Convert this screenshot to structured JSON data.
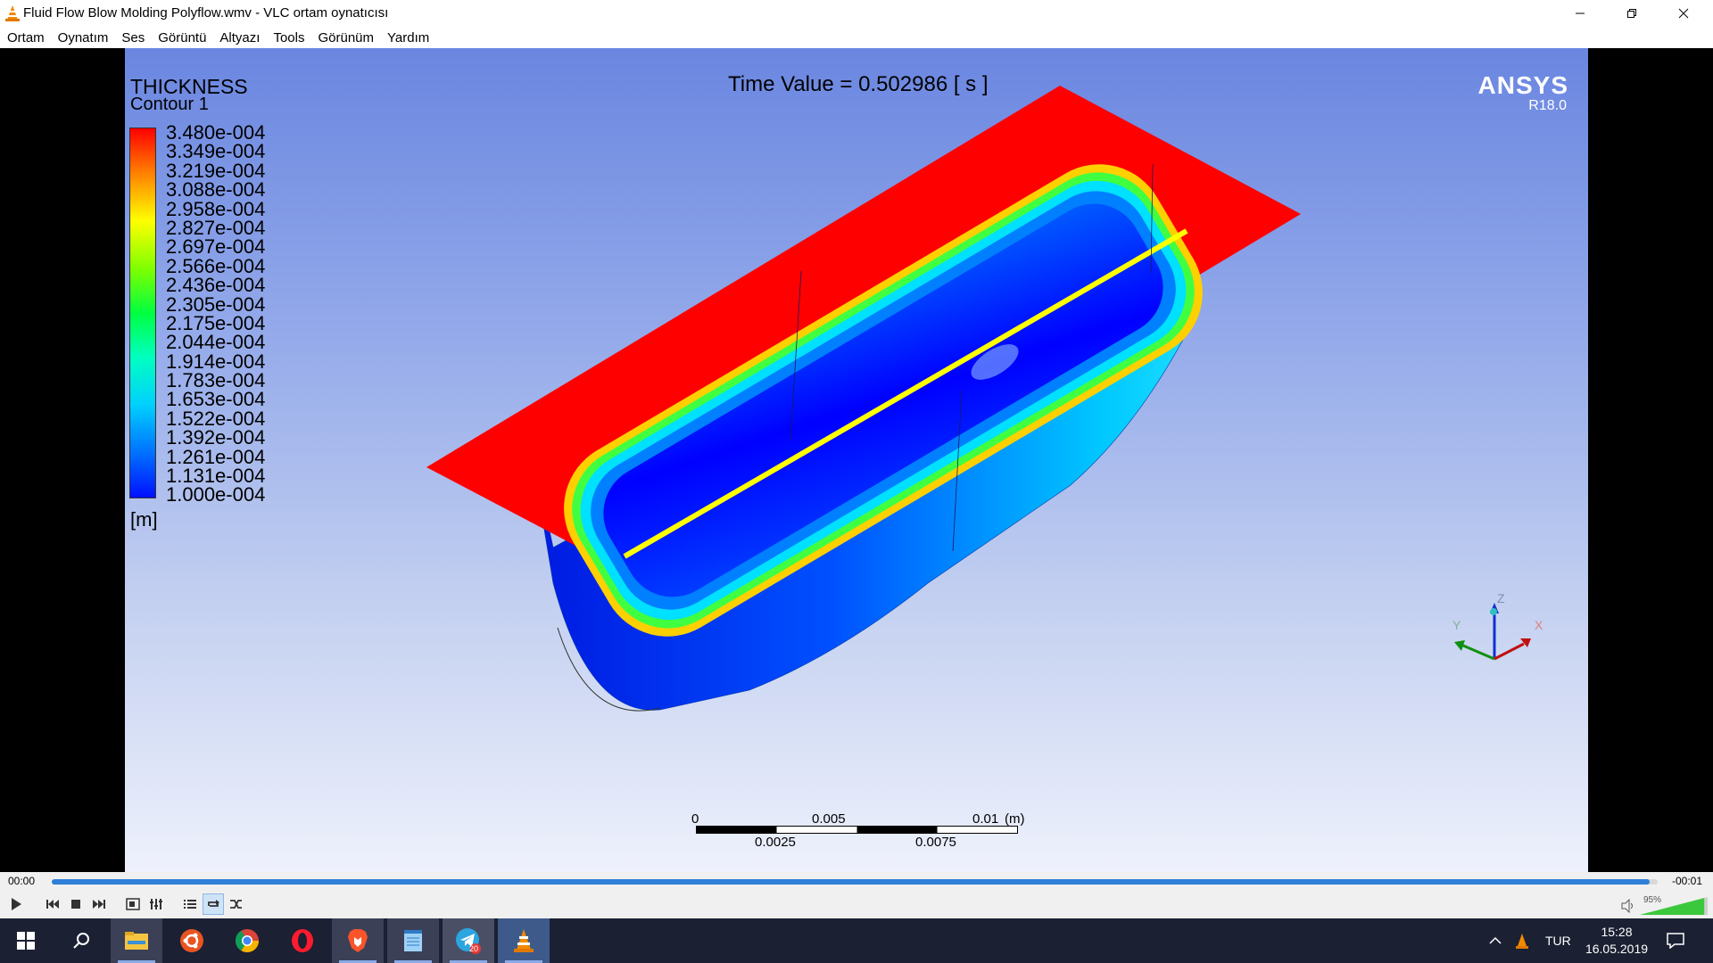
{
  "window": {
    "title": "Fluid Flow Blow Molding Polyflow.wmv - VLC ortam oynatıcısı",
    "icon": "vlc-cone-icon",
    "controls": [
      "minimize-icon",
      "restore-icon",
      "close-icon"
    ]
  },
  "menu": [
    "Ortam",
    "Oynatım",
    "Ses",
    "Görüntü",
    "Altyazı",
    "Tools",
    "Görünüm",
    "Yardım"
  ],
  "video": {
    "legend_title": "THICKNESS",
    "legend_subtitle": "Contour 1",
    "legend_values": [
      "3.480e-004",
      "3.349e-004",
      "3.219e-004",
      "3.088e-004",
      "2.958e-004",
      "2.827e-004",
      "2.697e-004",
      "2.566e-004",
      "2.436e-004",
      "2.305e-004",
      "2.175e-004",
      "2.044e-004",
      "1.914e-004",
      "1.783e-004",
      "1.653e-004",
      "1.522e-004",
      "1.392e-004",
      "1.261e-004",
      "1.131e-004",
      "1.000e-004"
    ],
    "legend_unit": "[m]",
    "time_value": "Time Value = 0.502986 [ s ]",
    "brand": "ANSYS",
    "brand_version": "R18.0",
    "axes": {
      "z": "Z",
      "y": "Y",
      "x": "X"
    },
    "scale_top": [
      "0",
      "0.005",
      "0.01",
      "(m)"
    ],
    "scale_bottom": [
      "0.0025",
      "0.0075"
    ]
  },
  "playback": {
    "elapsed": "00:00",
    "remaining": "-00:01",
    "progress": 0.995,
    "volume": "95%",
    "volume_level": 0.95
  },
  "taskbar": {
    "apps": [
      "windows-start-icon",
      "search-icon",
      "file-explorer-icon",
      "ubuntu-icon",
      "chrome-icon",
      "opera-icon",
      "brave-icon",
      "notepad-icon",
      "telegram-icon",
      "vlc-icon"
    ],
    "telegram_badge": "20",
    "language": "TUR",
    "time": "15:28",
    "date": "16.05.2019"
  }
}
